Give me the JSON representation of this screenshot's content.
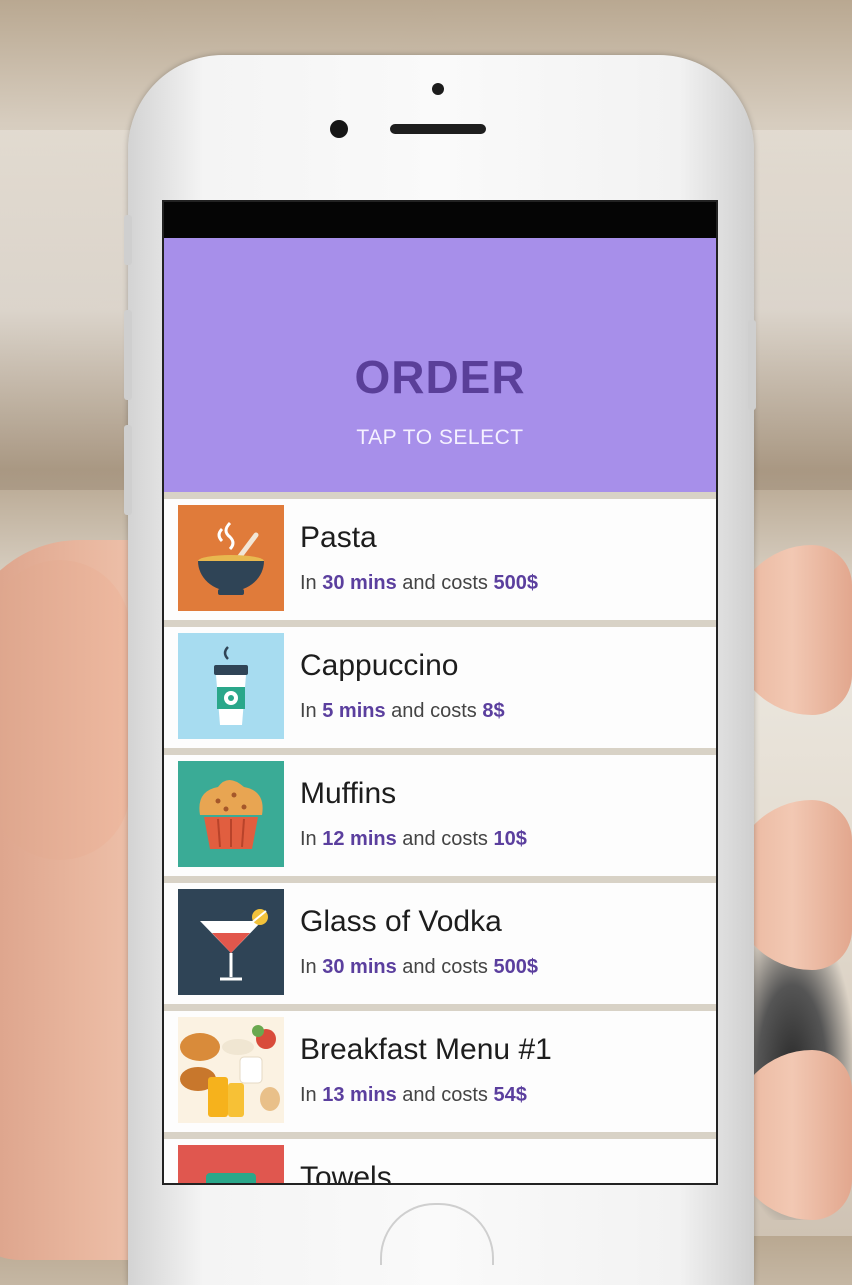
{
  "header": {
    "title": "ORDER",
    "subtitle": "TAP TO SELECT"
  },
  "menu": {
    "prefix": "In",
    "middle": "and costs",
    "items": [
      {
        "name": "Pasta",
        "time": "30 mins",
        "price": "500$",
        "icon": "soup-bowl-icon",
        "color": "#e07b3a"
      },
      {
        "name": "Cappuccino",
        "time": "5 mins",
        "price": "8$",
        "icon": "coffee-cup-icon",
        "color": "#a7dcf0"
      },
      {
        "name": "Muffins",
        "time": "12 mins",
        "price": "10$",
        "icon": "muffin-icon",
        "color": "#3aab96"
      },
      {
        "name": "Glass of Vodka",
        "time": "30 mins",
        "price": "500$",
        "icon": "cocktail-glass-icon",
        "color": "#2f4456"
      },
      {
        "name": "Breakfast Menu #1",
        "time": "13 mins",
        "price": "54$",
        "icon": "breakfast-photo",
        "color": "#f3c36b"
      },
      {
        "name": "Towels",
        "icon": "towel-icon",
        "color": "#e0574f"
      }
    ]
  },
  "colors": {
    "header_bg": "#a78fea",
    "accent": "#5b3f9e"
  }
}
